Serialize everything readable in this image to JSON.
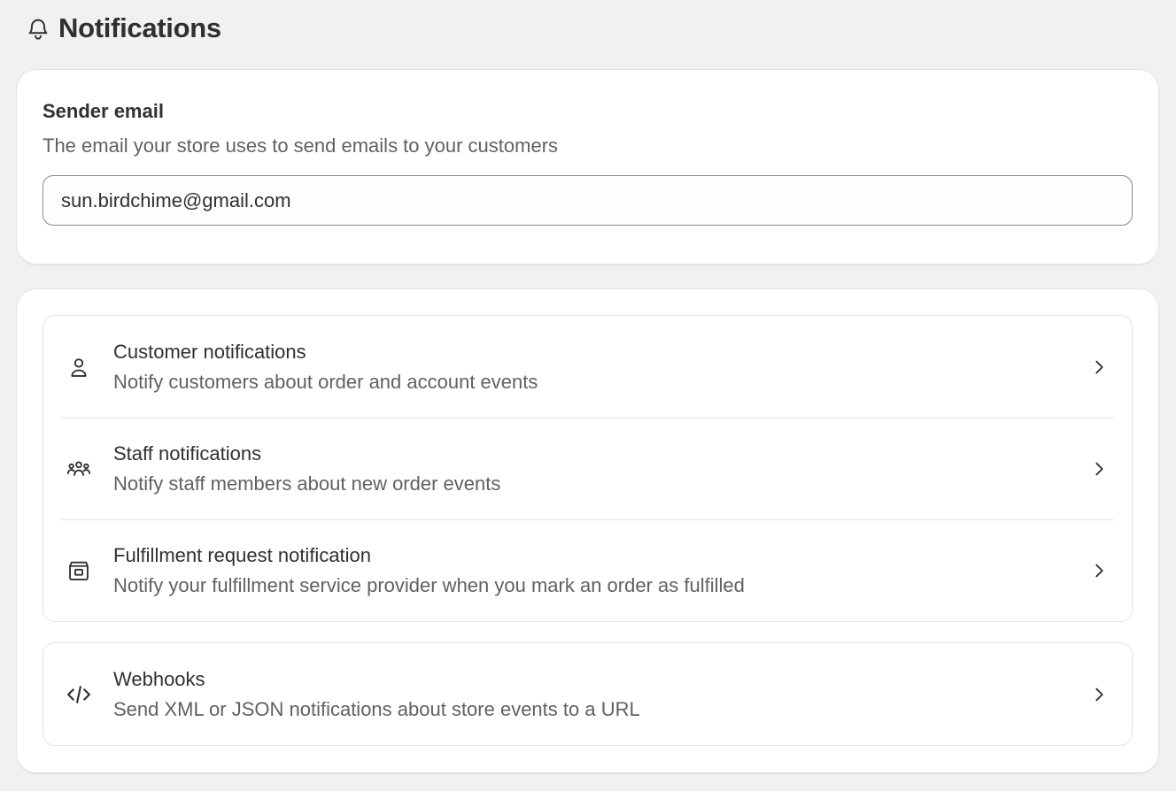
{
  "page": {
    "title": "Notifications",
    "title_icon": "bell-icon"
  },
  "sender": {
    "title": "Sender email",
    "description": "The email your store uses to send emails to your customers",
    "email_value": "sun.birdchime@gmail.com"
  },
  "groups": [
    {
      "items": [
        {
          "icon": "person-icon",
          "title": "Customer notifications",
          "description": "Notify customers about order and account events"
        },
        {
          "icon": "people-icon",
          "title": "Staff notifications",
          "description": "Notify staff members about new order events"
        },
        {
          "icon": "package-icon",
          "title": "Fulfillment request notification",
          "description": "Notify your fulfillment service provider when you mark an order as fulfilled"
        }
      ]
    },
    {
      "items": [
        {
          "icon": "code-icon",
          "title": "Webhooks",
          "description": "Send XML or JSON notifications about store events to a URL"
        }
      ]
    }
  ],
  "colors": {
    "background": "#f1f1f1",
    "card": "#ffffff",
    "text_primary": "#303030",
    "text_secondary": "#616161",
    "border": "#e3e3e3"
  }
}
